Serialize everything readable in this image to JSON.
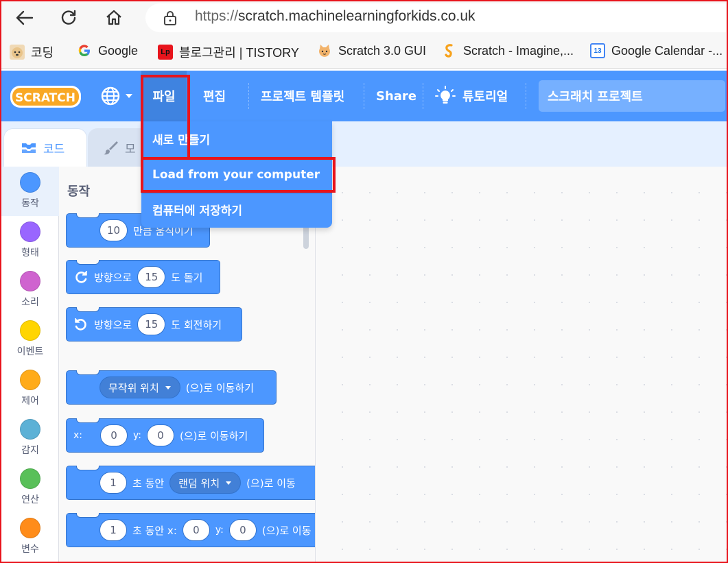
{
  "browser": {
    "url_scheme": "https://",
    "url_host": "scratch.machinelearningforkids.co.uk",
    "bookmarks": [
      {
        "label": "코딩",
        "icon": "dog-favicon-icon"
      },
      {
        "label": "Google",
        "icon": "google-favicon-icon"
      },
      {
        "label": "블로그관리 | TISTORY",
        "icon": "lp-favicon-icon"
      },
      {
        "label": "Scratch 3.0 GUI",
        "icon": "cat-favicon-icon"
      },
      {
        "label": "Scratch - Imagine,...",
        "icon": "scratch-favicon-icon"
      },
      {
        "label": "Google Calendar -...",
        "icon": "calendar-favicon-icon"
      }
    ],
    "calendar_day": "13"
  },
  "menubar": {
    "logo_text": "SCRATCH",
    "file": "파일",
    "edit": "편집",
    "templates": "프로젝트 템플릿",
    "share": "Share",
    "tutorials": "튜토리얼",
    "project_title": "스크래치 프로젝트"
  },
  "file_menu": {
    "items": [
      "새로 만들기",
      "Load from your computer",
      "컴퓨터에 저장하기"
    ]
  },
  "tabs": {
    "code": "코드",
    "costume": "모"
  },
  "categories": [
    {
      "label": "동작",
      "color": "#4c97ff"
    },
    {
      "label": "형태",
      "color": "#9966ff"
    },
    {
      "label": "소리",
      "color": "#cf63cf"
    },
    {
      "label": "이벤트",
      "color": "#ffd500"
    },
    {
      "label": "제어",
      "color": "#ffab19"
    },
    {
      "label": "감지",
      "color": "#5cb1d6"
    },
    {
      "label": "연산",
      "color": "#59c059"
    },
    {
      "label": "변수",
      "color": "#ff8c1a"
    }
  ],
  "palette": {
    "title": "동작",
    "blocks": {
      "move_steps": "10",
      "move_text": "만큼 움직이기",
      "turn_right_prefix": "방향으로",
      "turn_right_value": "15",
      "turn_right_suffix": "도 돌기",
      "turn_left_prefix": "방향으로",
      "turn_left_value": "15",
      "turn_left_suffix": "도 회전하기",
      "goto_target": "무작위 위치",
      "goto_suffix": "(으)로 이동하기",
      "gotoxy_x_label": "x:",
      "gotoxy_x": "0",
      "gotoxy_y_label": "y:",
      "gotoxy_y": "0",
      "gotoxy_suffix": "(으)로 이동하기",
      "glide_secs": "1",
      "glide_mid": "초 동안",
      "glide_target": "랜덤 위치",
      "glide_suffix": "(으)로 이동",
      "glidexy_secs": "1",
      "glidexy_mid": "초 동안 x:",
      "glidexy_x": "0",
      "glidexy_y_label": "y:",
      "glidexy_y": "0",
      "glidexy_suffix": "(으)로 이동"
    }
  }
}
